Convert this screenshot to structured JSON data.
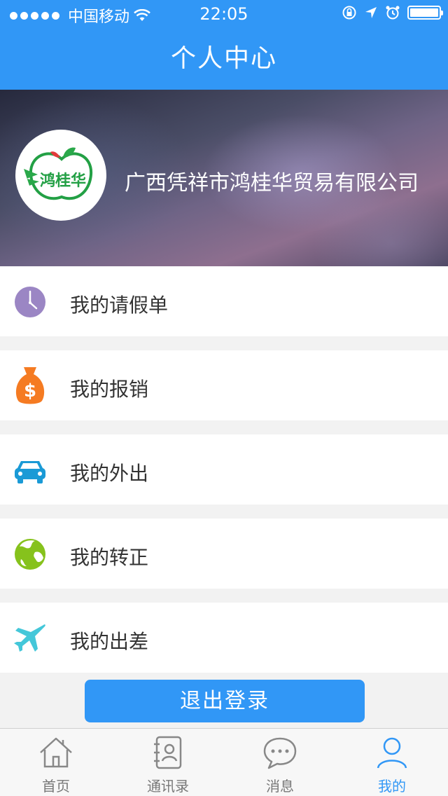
{
  "status_bar": {
    "carrier": "中国移动",
    "time": "22:05"
  },
  "header": {
    "title": "个人中心"
  },
  "profile": {
    "company_name": "广西凭祥市鸿桂华贸易有限公司",
    "logo_text": "鸿桂华"
  },
  "menu": [
    {
      "label": "我的请假单",
      "icon": "clock-icon",
      "color": "#9b86c4"
    },
    {
      "label": "我的报销",
      "icon": "money-bag-icon",
      "color": "#f57b22"
    },
    {
      "label": "我的外出",
      "icon": "car-icon",
      "color": "#1a9ad6"
    },
    {
      "label": "我的转正",
      "icon": "globe-icon",
      "color": "#86c21c"
    },
    {
      "label": "我的出差",
      "icon": "airplane-icon",
      "color": "#44c7d9"
    }
  ],
  "logout_label": "退出登录",
  "tabs": [
    {
      "label": "首页",
      "icon": "home-icon"
    },
    {
      "label": "通讯录",
      "icon": "contacts-icon"
    },
    {
      "label": "消息",
      "icon": "message-icon"
    },
    {
      "label": "我的",
      "icon": "user-icon",
      "active": true
    }
  ],
  "colors": {
    "primary": "#3197f6",
    "background": "#f2f2f2"
  }
}
